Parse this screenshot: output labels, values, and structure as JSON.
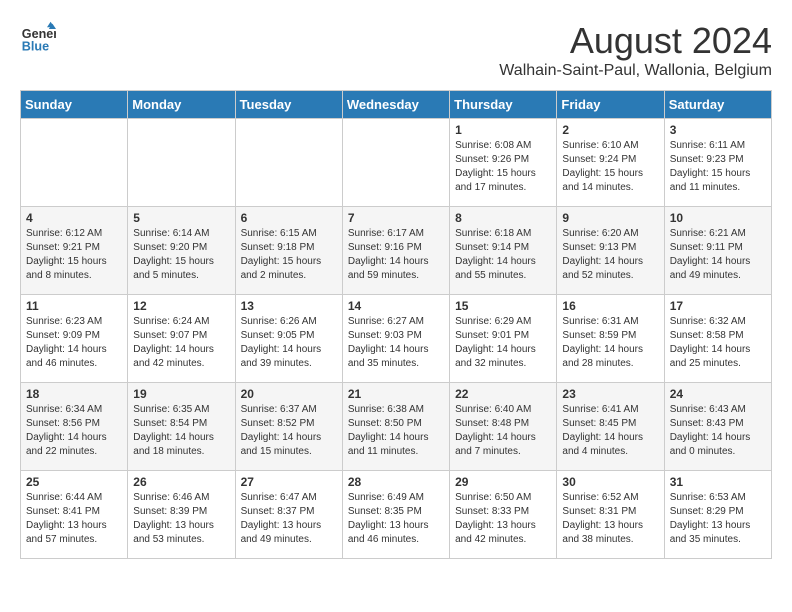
{
  "header": {
    "logo_line1": "General",
    "logo_line2": "Blue",
    "title": "August 2024",
    "subtitle": "Walhain-Saint-Paul, Wallonia, Belgium"
  },
  "weekdays": [
    "Sunday",
    "Monday",
    "Tuesday",
    "Wednesday",
    "Thursday",
    "Friday",
    "Saturday"
  ],
  "weeks": [
    [
      {
        "day": "",
        "info": ""
      },
      {
        "day": "",
        "info": ""
      },
      {
        "day": "",
        "info": ""
      },
      {
        "day": "",
        "info": ""
      },
      {
        "day": "1",
        "info": "Sunrise: 6:08 AM\nSunset: 9:26 PM\nDaylight: 15 hours\nand 17 minutes."
      },
      {
        "day": "2",
        "info": "Sunrise: 6:10 AM\nSunset: 9:24 PM\nDaylight: 15 hours\nand 14 minutes."
      },
      {
        "day": "3",
        "info": "Sunrise: 6:11 AM\nSunset: 9:23 PM\nDaylight: 15 hours\nand 11 minutes."
      }
    ],
    [
      {
        "day": "4",
        "info": "Sunrise: 6:12 AM\nSunset: 9:21 PM\nDaylight: 15 hours\nand 8 minutes."
      },
      {
        "day": "5",
        "info": "Sunrise: 6:14 AM\nSunset: 9:20 PM\nDaylight: 15 hours\nand 5 minutes."
      },
      {
        "day": "6",
        "info": "Sunrise: 6:15 AM\nSunset: 9:18 PM\nDaylight: 15 hours\nand 2 minutes."
      },
      {
        "day": "7",
        "info": "Sunrise: 6:17 AM\nSunset: 9:16 PM\nDaylight: 14 hours\nand 59 minutes."
      },
      {
        "day": "8",
        "info": "Sunrise: 6:18 AM\nSunset: 9:14 PM\nDaylight: 14 hours\nand 55 minutes."
      },
      {
        "day": "9",
        "info": "Sunrise: 6:20 AM\nSunset: 9:13 PM\nDaylight: 14 hours\nand 52 minutes."
      },
      {
        "day": "10",
        "info": "Sunrise: 6:21 AM\nSunset: 9:11 PM\nDaylight: 14 hours\nand 49 minutes."
      }
    ],
    [
      {
        "day": "11",
        "info": "Sunrise: 6:23 AM\nSunset: 9:09 PM\nDaylight: 14 hours\nand 46 minutes."
      },
      {
        "day": "12",
        "info": "Sunrise: 6:24 AM\nSunset: 9:07 PM\nDaylight: 14 hours\nand 42 minutes."
      },
      {
        "day": "13",
        "info": "Sunrise: 6:26 AM\nSunset: 9:05 PM\nDaylight: 14 hours\nand 39 minutes."
      },
      {
        "day": "14",
        "info": "Sunrise: 6:27 AM\nSunset: 9:03 PM\nDaylight: 14 hours\nand 35 minutes."
      },
      {
        "day": "15",
        "info": "Sunrise: 6:29 AM\nSunset: 9:01 PM\nDaylight: 14 hours\nand 32 minutes."
      },
      {
        "day": "16",
        "info": "Sunrise: 6:31 AM\nSunset: 8:59 PM\nDaylight: 14 hours\nand 28 minutes."
      },
      {
        "day": "17",
        "info": "Sunrise: 6:32 AM\nSunset: 8:58 PM\nDaylight: 14 hours\nand 25 minutes."
      }
    ],
    [
      {
        "day": "18",
        "info": "Sunrise: 6:34 AM\nSunset: 8:56 PM\nDaylight: 14 hours\nand 22 minutes."
      },
      {
        "day": "19",
        "info": "Sunrise: 6:35 AM\nSunset: 8:54 PM\nDaylight: 14 hours\nand 18 minutes."
      },
      {
        "day": "20",
        "info": "Sunrise: 6:37 AM\nSunset: 8:52 PM\nDaylight: 14 hours\nand 15 minutes."
      },
      {
        "day": "21",
        "info": "Sunrise: 6:38 AM\nSunset: 8:50 PM\nDaylight: 14 hours\nand 11 minutes."
      },
      {
        "day": "22",
        "info": "Sunrise: 6:40 AM\nSunset: 8:48 PM\nDaylight: 14 hours\nand 7 minutes."
      },
      {
        "day": "23",
        "info": "Sunrise: 6:41 AM\nSunset: 8:45 PM\nDaylight: 14 hours\nand 4 minutes."
      },
      {
        "day": "24",
        "info": "Sunrise: 6:43 AM\nSunset: 8:43 PM\nDaylight: 14 hours\nand 0 minutes."
      }
    ],
    [
      {
        "day": "25",
        "info": "Sunrise: 6:44 AM\nSunset: 8:41 PM\nDaylight: 13 hours\nand 57 minutes."
      },
      {
        "day": "26",
        "info": "Sunrise: 6:46 AM\nSunset: 8:39 PM\nDaylight: 13 hours\nand 53 minutes."
      },
      {
        "day": "27",
        "info": "Sunrise: 6:47 AM\nSunset: 8:37 PM\nDaylight: 13 hours\nand 49 minutes."
      },
      {
        "day": "28",
        "info": "Sunrise: 6:49 AM\nSunset: 8:35 PM\nDaylight: 13 hours\nand 46 minutes."
      },
      {
        "day": "29",
        "info": "Sunrise: 6:50 AM\nSunset: 8:33 PM\nDaylight: 13 hours\nand 42 minutes."
      },
      {
        "day": "30",
        "info": "Sunrise: 6:52 AM\nSunset: 8:31 PM\nDaylight: 13 hours\nand 38 minutes."
      },
      {
        "day": "31",
        "info": "Sunrise: 6:53 AM\nSunset: 8:29 PM\nDaylight: 13 hours\nand 35 minutes."
      }
    ]
  ]
}
